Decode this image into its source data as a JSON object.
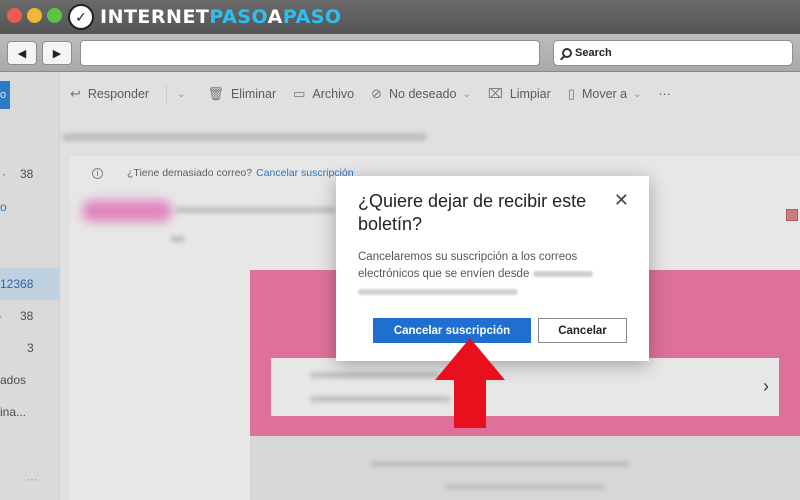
{
  "branding": {
    "part1": "INTERNET",
    "part2": "PASO",
    "part3": "A",
    "part4": "PASO"
  },
  "browser": {
    "search_placeholder": "Search"
  },
  "commands": [
    {
      "label": "Responder",
      "icon": "reply-icon",
      "chevron": true
    },
    {
      "label": "Eliminar",
      "icon": "trash-icon"
    },
    {
      "label": "Archivo",
      "icon": "archive-icon"
    },
    {
      "label": "No deseado",
      "icon": "block-icon",
      "chevron": true
    },
    {
      "label": "Limpiar",
      "icon": "sweep-icon"
    },
    {
      "label": "Mover a",
      "icon": "move-icon",
      "chevron": true
    },
    {
      "label": "···",
      "icon": "more-icon"
    }
  ],
  "folders": [
    {
      "label": "38"
    },
    {
      "label": "o"
    },
    {
      "label": "12368"
    },
    {
      "label": "38"
    },
    {
      "label": "3"
    },
    {
      "label": "ados"
    },
    {
      "label": "ina..."
    },
    {
      "label": "···"
    }
  ],
  "infobar": {
    "text": "¿Tiene demasiado correo?",
    "link": "Cancelar suscripción"
  },
  "dialog": {
    "title": "¿Quiere dejar de recibir este boletín?",
    "body": "Cancelaremos su suscripción a los correos electrónicos que se envíen desde",
    "primary_button": "Cancelar suscripción",
    "secondary_button": "Cancelar",
    "close_symbol": "✕"
  },
  "colors": {
    "accent_blue": "#1e6fd0",
    "pink_banner": "#f46fa4",
    "arrow_red": "#e8101c"
  }
}
